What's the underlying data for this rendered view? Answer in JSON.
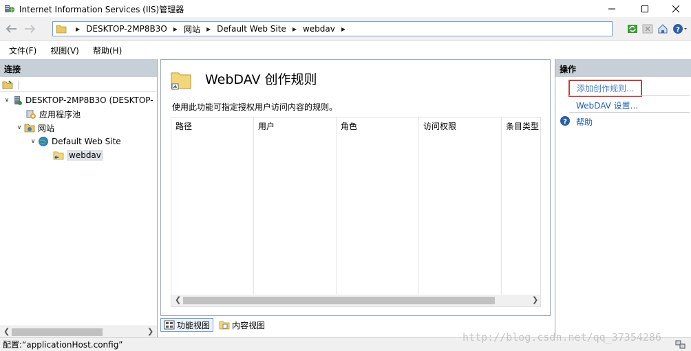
{
  "window": {
    "title": "Internet Information Services (IIS)管理器",
    "minimize_glyph": "—",
    "maximize_glyph": "☐",
    "close_glyph": "✕"
  },
  "address": {
    "breadcrumbs": [
      "DESKTOP-2MP8B3O",
      "网站",
      "Default Web Site",
      "webdav"
    ]
  },
  "menu": {
    "file": "文件(F)",
    "view": "视图(V)",
    "help": "帮助(H)"
  },
  "connections": {
    "header": "连接",
    "tree": {
      "server": "DESKTOP-2MP8B3O (DESKTOP-",
      "app_pools": "应用程序池",
      "sites": "网站",
      "default_site": "Default Web Site",
      "webdav": "webdav"
    }
  },
  "center": {
    "title": "WebDAV 创作规则",
    "description": "使用此功能可指定授权用户访问内容的规则。",
    "columns": [
      "路径",
      "用户",
      "角色",
      "访问权限",
      "条目类型"
    ],
    "views": {
      "feature": "功能视图",
      "content": "内容视图"
    }
  },
  "actions": {
    "header": "操作",
    "add_rule": "添加创作规则...",
    "webdav_settings": "WebDAV 设置...",
    "help": "帮助"
  },
  "status": {
    "text": "配置:“applicationHost.config”"
  },
  "watermark": "http://blog.csdn.net/qq_37354286",
  "colors": {
    "pane_header": "#c7cfd7",
    "link": "#1e5fb3",
    "highlight_box": "#d03a3a"
  }
}
